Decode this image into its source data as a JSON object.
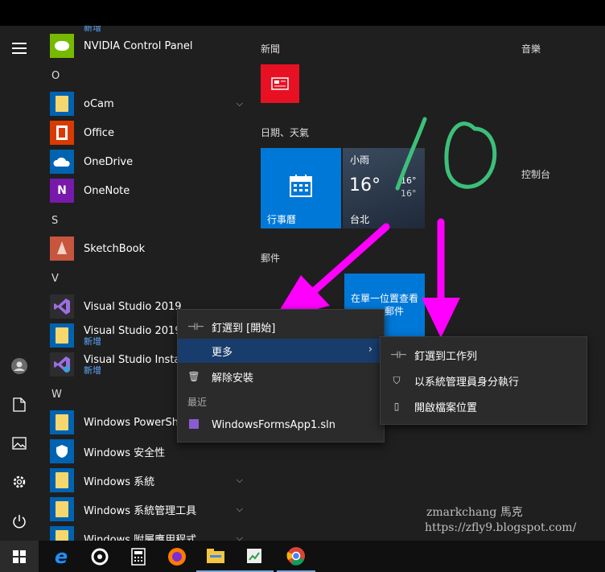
{
  "app_list": {
    "truncated_top_label": "新增",
    "nvidia": "NVIDIA Control Panel",
    "letter_o": "O",
    "ocam": "oCam",
    "office": "Office",
    "onedrive": "OneDrive",
    "onenote": "OneNote",
    "letter_s": "S",
    "sketchbook": "SketchBook",
    "letter_v": "V",
    "vs2019a": "Visual Studio 2019",
    "vs2019b": "Visual Studio 2019",
    "vs2019b_sub": "新增",
    "vsinstaller": "Visual Studio Installe",
    "vsinstaller_sub": "新增",
    "letter_w": "W",
    "powershell": "Windows PowerShel",
    "security": "Windows 安全性",
    "system": "Windows 系統",
    "admin_tools": "Windows 系統管理工具",
    "accessories": "Windows 附屬應用程式"
  },
  "tiles": {
    "group_news": "新聞",
    "group_music": "音樂",
    "group_datetime": "日期、天氣",
    "calendar_label": "行事曆",
    "weather_cond": "小雨",
    "weather_temp": "16°",
    "weather_hi": "16°",
    "weather_lo": "16°",
    "weather_city": "台北",
    "control_panel": "控制台",
    "group_mail": "郵件",
    "mail_text": "在單一位置查看",
    "mail_label": "郵件"
  },
  "context_menu": {
    "pin_start": "釘選到 [開始]",
    "more": "更多",
    "uninstall": "解除安裝",
    "recent_header": "最近",
    "recent_item": "WindowsFormsApp1.sln"
  },
  "submenu": {
    "pin_taskbar": "釘選到工作列",
    "run_admin": "以系統管理員身分執行",
    "open_location": "開啟檔案位置"
  },
  "annotation": {
    "handwriting": "10"
  },
  "watermark": {
    "line1": "zmarkchang 馬克",
    "line2": "https://zfly9.blogspot.com/"
  },
  "colors": {
    "accent": "#0078d7",
    "arrow": "#ff00ff",
    "scribble": "#3dbf7a",
    "news_tile": "#e81123"
  }
}
